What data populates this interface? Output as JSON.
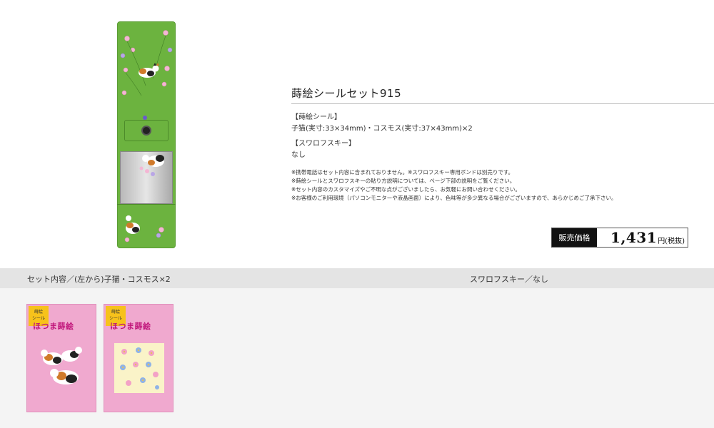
{
  "product": {
    "title": "蒔絵シールセット915",
    "sections": [
      {
        "label": "【蒔絵シール】",
        "text": "子猫(実寸:33×34mm)・コスモス(実寸:37×43mm)×2"
      },
      {
        "label": "【スワロフスキー】",
        "text": "なし"
      }
    ],
    "notes": [
      "※携帯電話はセット内容に含まれておりません。※スワロフスキー専用ボンドは別売りです。",
      "※蒔絵シールとスワロフスキーの貼り方説明については、ページ下部の説明をご覧ください。",
      "※セット内容のカスタマイズやご不明な点がございましたら、お気軽にお問い合わせください。",
      "※お客様のご利用環境（パソコンモニターや液晶画面）により、色味等が多少異なる場合がございますので、あらかじめご了承下さい。"
    ],
    "price": {
      "label": "販売価格",
      "value": "1,431",
      "unit": "円(税抜)"
    }
  },
  "set_contents": {
    "left_heading": "セット内容／(左から)子猫・コスモス×2",
    "right_heading": "スワロフスキー／なし",
    "packages": [
      {
        "tag": "蒔絵\nシール",
        "name": "ほつま蒔絵",
        "art": "kitten"
      },
      {
        "tag": "蒔絵\nシール",
        "name": "ほつま蒔絵",
        "art": "cosmos"
      }
    ]
  },
  "colors": {
    "phone_green": "#6cb33f",
    "package_pink": "#f0a9cf",
    "price_label_bg": "#111111"
  }
}
